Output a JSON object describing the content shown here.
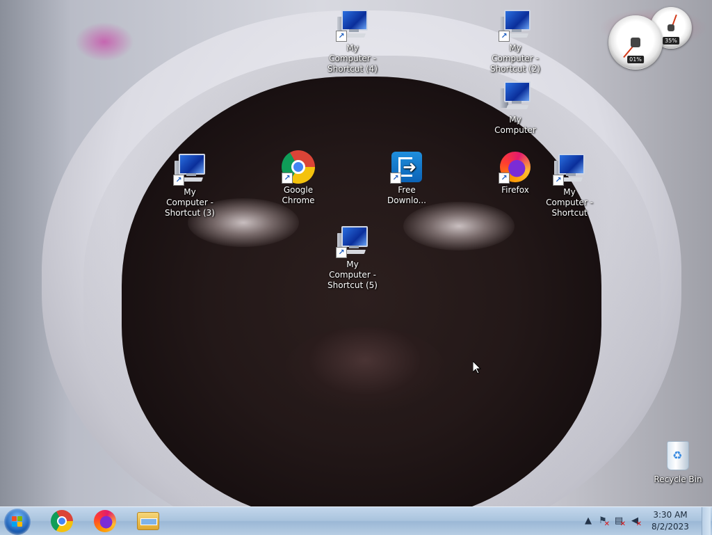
{
  "desktop": {
    "icons": [
      {
        "label": "My Computer - Shortcut (4)",
        "type": "computer-shortcut"
      },
      {
        "label": "My Computer - Shortcut (2)",
        "type": "computer-shortcut"
      },
      {
        "label": "My Computer",
        "type": "computer"
      },
      {
        "label": "My Computer - Shortcut (3)",
        "type": "computer-shortcut"
      },
      {
        "label": "Google Chrome",
        "type": "chrome-shortcut"
      },
      {
        "label": "Free Downlo...",
        "type": "fdm-shortcut"
      },
      {
        "label": "Firefox",
        "type": "firefox-shortcut"
      },
      {
        "label": "My Computer - Shortcut",
        "type": "computer-shortcut"
      },
      {
        "label": "My Computer - Shortcut (5)",
        "type": "computer-shortcut"
      },
      {
        "label": "Recycle Bin",
        "type": "recycle-bin"
      }
    ]
  },
  "gadget": {
    "cpu_readout": "01%",
    "memory_readout": "35%"
  },
  "taskbar": {
    "pinned": [
      "Google Chrome",
      "Firefox",
      "Windows Explorer"
    ],
    "tray": {
      "time": "3:30 AM",
      "date": "8/2/2023"
    }
  },
  "colors": {
    "taskbar_top": "#c3d7ec",
    "taskbar_bottom": "#9bb8d6",
    "start_orb": "#1c5fb6"
  }
}
